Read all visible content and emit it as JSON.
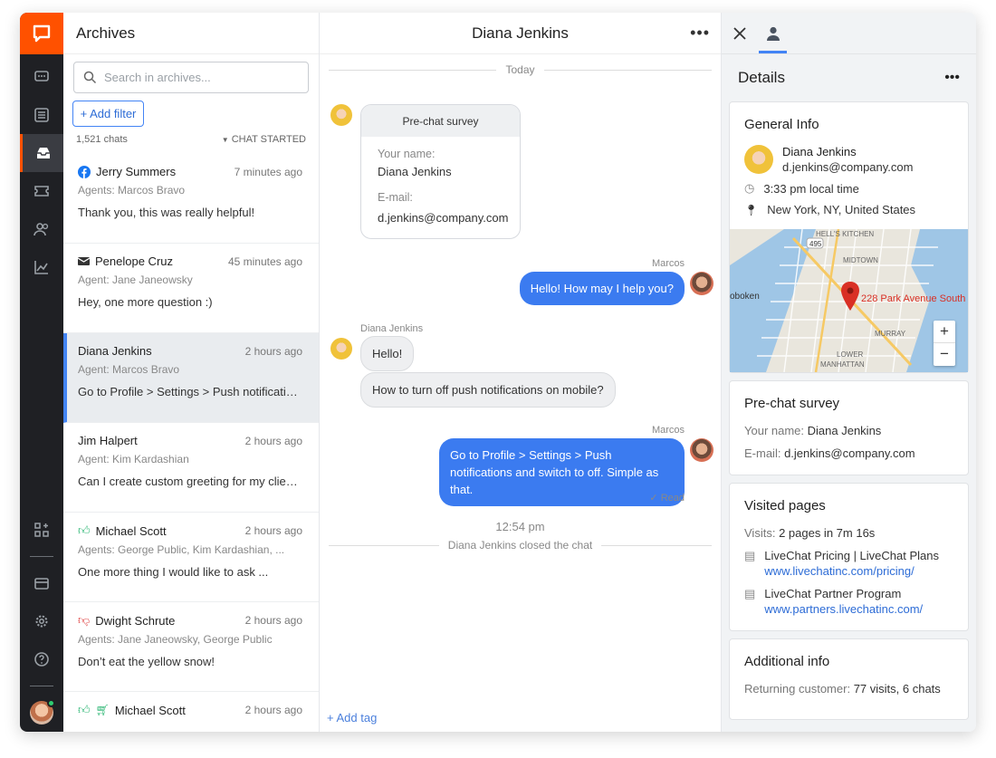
{
  "archives": {
    "title": "Archives",
    "search_placeholder": "Search in archives...",
    "add_filter": "+ Add filter",
    "count": "1,521 chats",
    "sort": "CHAT STARTED",
    "items": [
      {
        "name": "Jerry Summers",
        "time": "7 minutes ago",
        "agent": "Agents: Marcos Bravo",
        "msg": "Thank you, this was really helpful!",
        "icon": "facebook"
      },
      {
        "name": "Penelope Cruz",
        "time": "45 minutes ago",
        "agent": "Agent: Jane Janeowsky",
        "msg": "Hey, one more question :)",
        "icon": "mail"
      },
      {
        "name": "Diana Jenkins",
        "time": "2 hours ago",
        "agent": "Agent: Marcos Bravo",
        "msg": "Go to Profile > Settings > Push notifications...",
        "icon": ""
      },
      {
        "name": "Jim Halpert",
        "time": "2 hours ago",
        "agent": "Agent: Kim Kardashian",
        "msg": "Can I create custom greeting for my clients...",
        "icon": ""
      },
      {
        "name": "Michael Scott",
        "time": "2 hours ago",
        "agent": "Agents: George Public, Kim Kardashian, ...",
        "msg": "One more thing I would like to ask ...",
        "icon": "thumbs-up"
      },
      {
        "name": "Dwight Schrute",
        "time": "2 hours ago",
        "agent": "Agents: Jane Janeowsky, George Public",
        "msg": "Don’t eat the yellow snow!",
        "icon": "thumbs-down"
      },
      {
        "name": "Michael Scott",
        "time": "2 hours ago",
        "agent": "",
        "msg": "",
        "icon": "thumbs-up-cart"
      }
    ]
  },
  "chat": {
    "title": "Diana Jenkins",
    "today": "Today",
    "survey": {
      "title": "Pre-chat survey",
      "name_label": "Your name:",
      "name_value": "Diana Jenkins",
      "email_label": "E-mail:",
      "email_value": "d.jenkins@company.com"
    },
    "agent_name": "Marcos",
    "msg1": "Hello! How may I help you?",
    "customer_name": "Diana Jenkins",
    "msg2": "Hello!",
    "msg3": "How to turn off push notifications on mobile?",
    "msg4": "Go to Profile > Settings > Push notifications and switch to off. Simple as that.",
    "read": "✓ Read",
    "end_time": "12:54 pm",
    "closed": "Diana Jenkins closed the chat",
    "add_tag": "+ Add tag"
  },
  "details": {
    "title": "Details",
    "general": {
      "title": "General Info",
      "name": "Diana Jenkins",
      "email": "d.jenkins@company.com",
      "local_time": "3:33 pm local time",
      "location": "New York, NY, United States",
      "map_label": "228 Park Avenue South",
      "map_places": [
        "HELL'S KITCHEN",
        "MIDTOWN",
        "oboken",
        "MURRAY",
        "MANHATTAN",
        "LOWER",
        "495"
      ]
    },
    "survey": {
      "title": "Pre-chat survey",
      "name_k": "Your name:",
      "name_v": "Diana Jenkins",
      "email_k": "E-mail:",
      "email_v": "d.jenkins@company.com"
    },
    "visited": {
      "title": "Visited pages",
      "visits_k": "Visits:",
      "visits_v": "2 pages in 7m 16s",
      "p1_title": "LiveChat Pricing | LiveChat Plans",
      "p1_url": "www.livechatinc.com/pricing/",
      "p2_title": "LiveChat Partner Program",
      "p2_url": "www.partners.livechatinc.com/"
    },
    "additional": {
      "title": "Additional info",
      "ret_k": "Returning customer:",
      "ret_v": "77 visits, 6 chats"
    }
  },
  "colors": {
    "brand": "#ff5100",
    "accent": "#3b7bf0"
  }
}
